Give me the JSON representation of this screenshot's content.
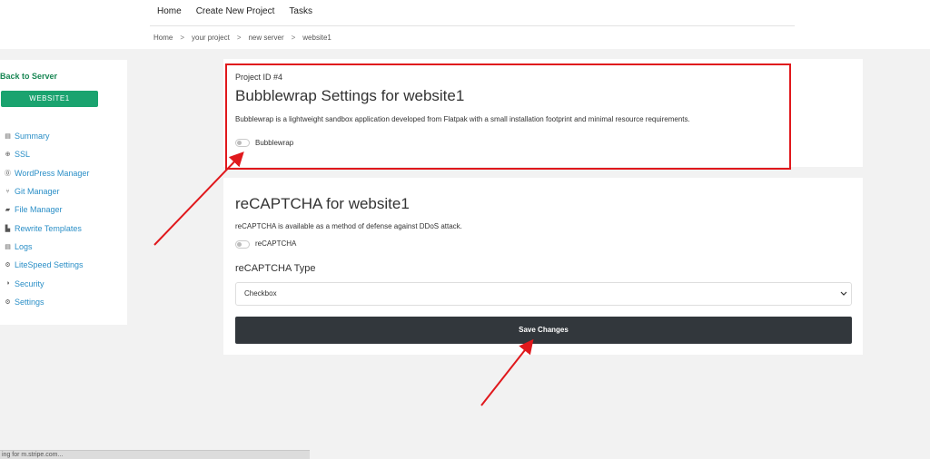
{
  "topnav": {
    "home": "Home",
    "create_project": "Create New Project",
    "tasks": "Tasks"
  },
  "breadcrumb": [
    "Home",
    "your project",
    "new server",
    "website1"
  ],
  "breadcrumb_sep": ">",
  "sidebar": {
    "back": "Back to Server",
    "site_button": "WEBSITE1",
    "items": [
      {
        "label": "Summary",
        "icon": "▤"
      },
      {
        "label": "SSL",
        "icon": "⊕"
      },
      {
        "label": "WordPress Manager",
        "icon": "⓪"
      },
      {
        "label": "Git Manager",
        "icon": "⑂"
      },
      {
        "label": "File Manager",
        "icon": "▰"
      },
      {
        "label": "Rewrite Templates",
        "icon": "▙"
      },
      {
        "label": "Logs",
        "icon": "▤"
      },
      {
        "label": "LiteSpeed Settings",
        "icon": "⚙"
      },
      {
        "label": "Security",
        "icon": "◑"
      },
      {
        "label": "Settings",
        "icon": "⚙"
      }
    ]
  },
  "bubblewrap": {
    "project_id": "Project ID #4",
    "title": "Bubblewrap Settings for website1",
    "description": "Bubblewrap is a lightweight sandbox application developed from Flatpak with a small installation footprint and minimal resource requirements.",
    "toggle_label": "Bubblewrap"
  },
  "recaptcha": {
    "title": "reCAPTCHA for website1",
    "description": "reCAPTCHA is available as a method of defense against DDoS attack.",
    "toggle_label": "reCAPTCHA",
    "type_label": "reCAPTCHA Type",
    "type_value": "Checkbox",
    "save_label": "Save Changes"
  },
  "status_bar": "ing for m.stripe.com...",
  "colors": {
    "accent_green": "#1aa36f",
    "link_blue": "#2b8fc7",
    "annotation_red": "#e0181c",
    "button_dark": "#32373c"
  }
}
